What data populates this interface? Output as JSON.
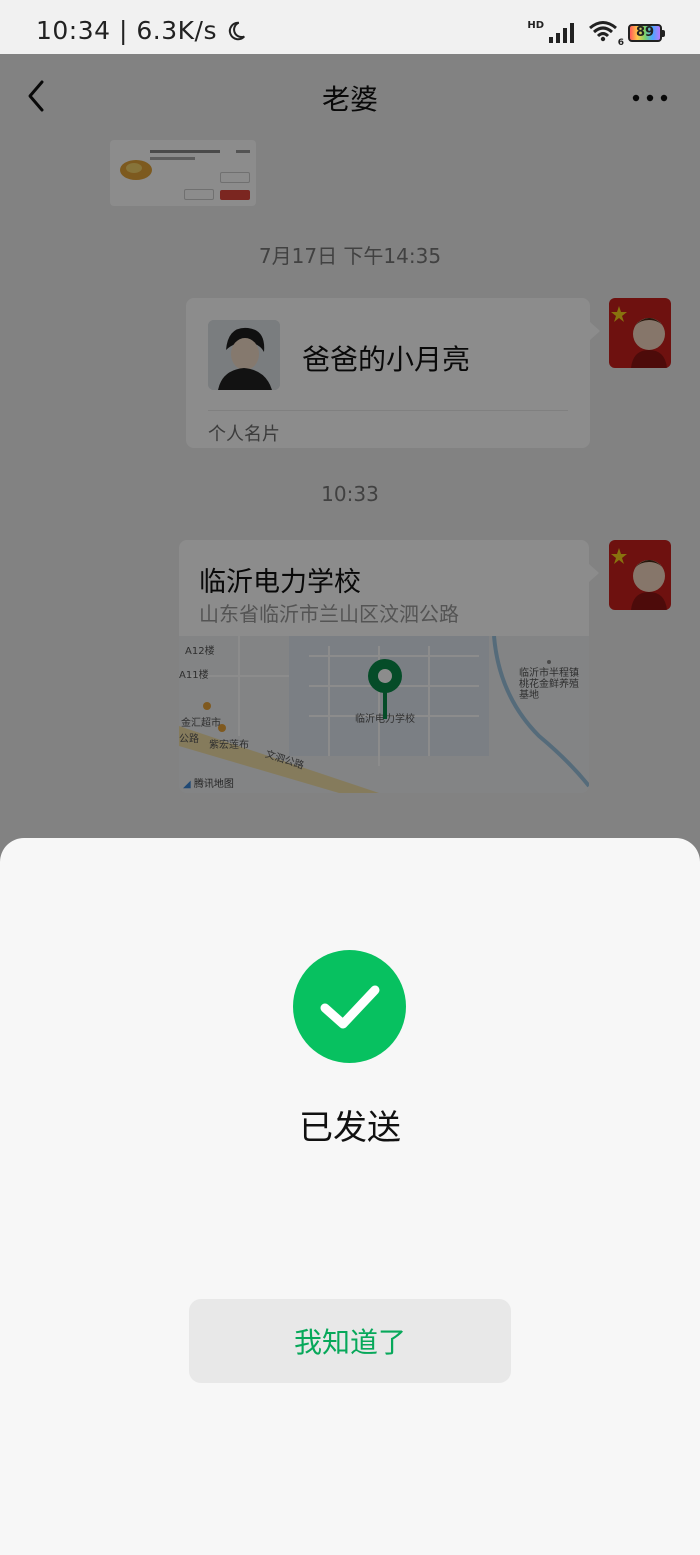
{
  "status_bar": {
    "time_speed": "10:34 | 6.3K/s",
    "network_label": "HD",
    "wifi_sub": "6",
    "battery": "89"
  },
  "nav": {
    "title": "老婆"
  },
  "chat": {
    "timestamp_1": "7月17日 下午14:35",
    "contact_card": {
      "name": "爸爸的小月亮",
      "label": "个人名片"
    },
    "timestamp_2": "10:33",
    "location": {
      "title": "临沂电力学校",
      "address": "山东省临沂市兰山区汶泗公路",
      "map_labels": {
        "a12": "A12楼",
        "a11": "A11楼",
        "jinhui": "金汇超市",
        "zihong": "紫宏莲布",
        "road_left": "公路",
        "wensi_road": "文泗公路",
        "pin_place": "临沂电力学校",
        "nursery": "临沂市半程镇桃花金鲜养殖基地",
        "provider": "腾讯地图"
      }
    }
  },
  "dialog": {
    "status_text": "已发送",
    "confirm_label": "我知道了"
  },
  "colors": {
    "accent_green": "#07c160",
    "overlay": "rgba(0,0,0,0.45)"
  }
}
